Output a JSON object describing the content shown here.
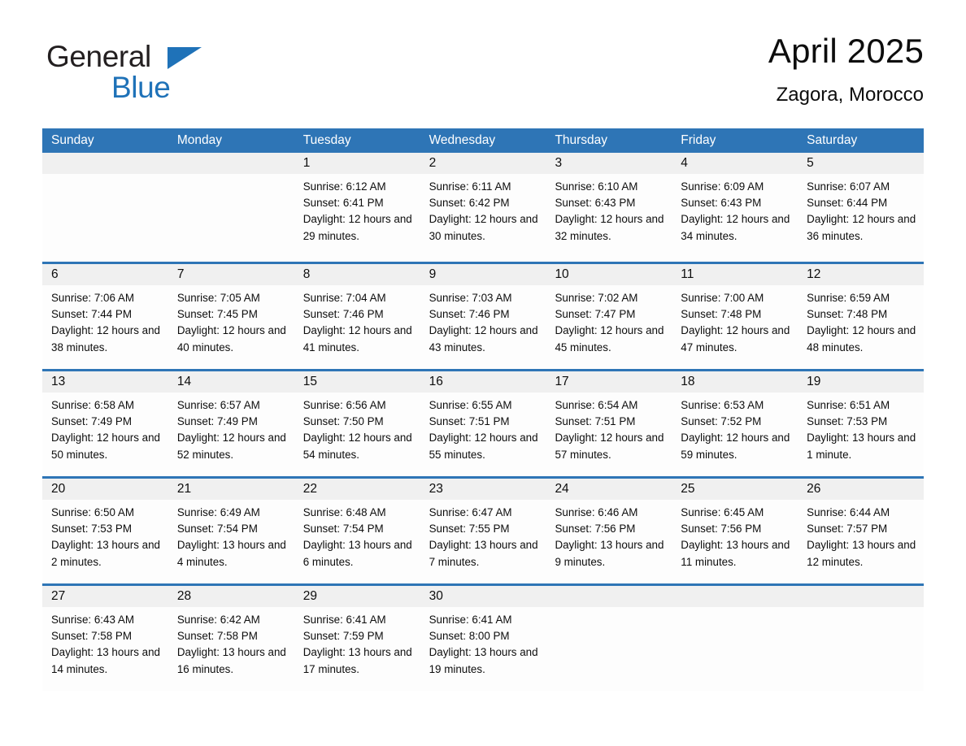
{
  "logo": {
    "word1": "General",
    "word2": "Blue",
    "triangle_color": "#1f72b8",
    "text_color": "#231f20"
  },
  "header": {
    "month_title": "April 2025",
    "location": "Zagora, Morocco"
  },
  "theme": {
    "header_blue": "#2e75b6",
    "day_band_grey": "#f0f0f0",
    "cell_white": "#fdfdfd"
  },
  "calendar": {
    "weekdays": [
      "Sunday",
      "Monday",
      "Tuesday",
      "Wednesday",
      "Thursday",
      "Friday",
      "Saturday"
    ],
    "weeks": [
      [
        {
          "day": "",
          "empty": true
        },
        {
          "day": "",
          "empty": true
        },
        {
          "day": "1",
          "sunrise": "Sunrise: 6:12 AM",
          "sunset": "Sunset: 6:41 PM",
          "daylight": "Daylight: 12 hours and 29 minutes."
        },
        {
          "day": "2",
          "sunrise": "Sunrise: 6:11 AM",
          "sunset": "Sunset: 6:42 PM",
          "daylight": "Daylight: 12 hours and 30 minutes."
        },
        {
          "day": "3",
          "sunrise": "Sunrise: 6:10 AM",
          "sunset": "Sunset: 6:43 PM",
          "daylight": "Daylight: 12 hours and 32 minutes."
        },
        {
          "day": "4",
          "sunrise": "Sunrise: 6:09 AM",
          "sunset": "Sunset: 6:43 PM",
          "daylight": "Daylight: 12 hours and 34 minutes."
        },
        {
          "day": "5",
          "sunrise": "Sunrise: 6:07 AM",
          "sunset": "Sunset: 6:44 PM",
          "daylight": "Daylight: 12 hours and 36 minutes."
        }
      ],
      [
        {
          "day": "6",
          "sunrise": "Sunrise: 7:06 AM",
          "sunset": "Sunset: 7:44 PM",
          "daylight": "Daylight: 12 hours and 38 minutes."
        },
        {
          "day": "7",
          "sunrise": "Sunrise: 7:05 AM",
          "sunset": "Sunset: 7:45 PM",
          "daylight": "Daylight: 12 hours and 40 minutes."
        },
        {
          "day": "8",
          "sunrise": "Sunrise: 7:04 AM",
          "sunset": "Sunset: 7:46 PM",
          "daylight": "Daylight: 12 hours and 41 minutes."
        },
        {
          "day": "9",
          "sunrise": "Sunrise: 7:03 AM",
          "sunset": "Sunset: 7:46 PM",
          "daylight": "Daylight: 12 hours and 43 minutes."
        },
        {
          "day": "10",
          "sunrise": "Sunrise: 7:02 AM",
          "sunset": "Sunset: 7:47 PM",
          "daylight": "Daylight: 12 hours and 45 minutes."
        },
        {
          "day": "11",
          "sunrise": "Sunrise: 7:00 AM",
          "sunset": "Sunset: 7:48 PM",
          "daylight": "Daylight: 12 hours and 47 minutes."
        },
        {
          "day": "12",
          "sunrise": "Sunrise: 6:59 AM",
          "sunset": "Sunset: 7:48 PM",
          "daylight": "Daylight: 12 hours and 48 minutes."
        }
      ],
      [
        {
          "day": "13",
          "sunrise": "Sunrise: 6:58 AM",
          "sunset": "Sunset: 7:49 PM",
          "daylight": "Daylight: 12 hours and 50 minutes."
        },
        {
          "day": "14",
          "sunrise": "Sunrise: 6:57 AM",
          "sunset": "Sunset: 7:49 PM",
          "daylight": "Daylight: 12 hours and 52 minutes."
        },
        {
          "day": "15",
          "sunrise": "Sunrise: 6:56 AM",
          "sunset": "Sunset: 7:50 PM",
          "daylight": "Daylight: 12 hours and 54 minutes."
        },
        {
          "day": "16",
          "sunrise": "Sunrise: 6:55 AM",
          "sunset": "Sunset: 7:51 PM",
          "daylight": "Daylight: 12 hours and 55 minutes."
        },
        {
          "day": "17",
          "sunrise": "Sunrise: 6:54 AM",
          "sunset": "Sunset: 7:51 PM",
          "daylight": "Daylight: 12 hours and 57 minutes."
        },
        {
          "day": "18",
          "sunrise": "Sunrise: 6:53 AM",
          "sunset": "Sunset: 7:52 PM",
          "daylight": "Daylight: 12 hours and 59 minutes."
        },
        {
          "day": "19",
          "sunrise": "Sunrise: 6:51 AM",
          "sunset": "Sunset: 7:53 PM",
          "daylight": "Daylight: 13 hours and 1 minute."
        }
      ],
      [
        {
          "day": "20",
          "sunrise": "Sunrise: 6:50 AM",
          "sunset": "Sunset: 7:53 PM",
          "daylight": "Daylight: 13 hours and 2 minutes."
        },
        {
          "day": "21",
          "sunrise": "Sunrise: 6:49 AM",
          "sunset": "Sunset: 7:54 PM",
          "daylight": "Daylight: 13 hours and 4 minutes."
        },
        {
          "day": "22",
          "sunrise": "Sunrise: 6:48 AM",
          "sunset": "Sunset: 7:54 PM",
          "daylight": "Daylight: 13 hours and 6 minutes."
        },
        {
          "day": "23",
          "sunrise": "Sunrise: 6:47 AM",
          "sunset": "Sunset: 7:55 PM",
          "daylight": "Daylight: 13 hours and 7 minutes."
        },
        {
          "day": "24",
          "sunrise": "Sunrise: 6:46 AM",
          "sunset": "Sunset: 7:56 PM",
          "daylight": "Daylight: 13 hours and 9 minutes."
        },
        {
          "day": "25",
          "sunrise": "Sunrise: 6:45 AM",
          "sunset": "Sunset: 7:56 PM",
          "daylight": "Daylight: 13 hours and 11 minutes."
        },
        {
          "day": "26",
          "sunrise": "Sunrise: 6:44 AM",
          "sunset": "Sunset: 7:57 PM",
          "daylight": "Daylight: 13 hours and 12 minutes."
        }
      ],
      [
        {
          "day": "27",
          "sunrise": "Sunrise: 6:43 AM",
          "sunset": "Sunset: 7:58 PM",
          "daylight": "Daylight: 13 hours and 14 minutes."
        },
        {
          "day": "28",
          "sunrise": "Sunrise: 6:42 AM",
          "sunset": "Sunset: 7:58 PM",
          "daylight": "Daylight: 13 hours and 16 minutes."
        },
        {
          "day": "29",
          "sunrise": "Sunrise: 6:41 AM",
          "sunset": "Sunset: 7:59 PM",
          "daylight": "Daylight: 13 hours and 17 minutes."
        },
        {
          "day": "30",
          "sunrise": "Sunrise: 6:41 AM",
          "sunset": "Sunset: 8:00 PM",
          "daylight": "Daylight: 13 hours and 19 minutes."
        },
        {
          "day": "",
          "empty": true
        },
        {
          "day": "",
          "empty": true
        },
        {
          "day": "",
          "empty": true
        }
      ]
    ]
  }
}
